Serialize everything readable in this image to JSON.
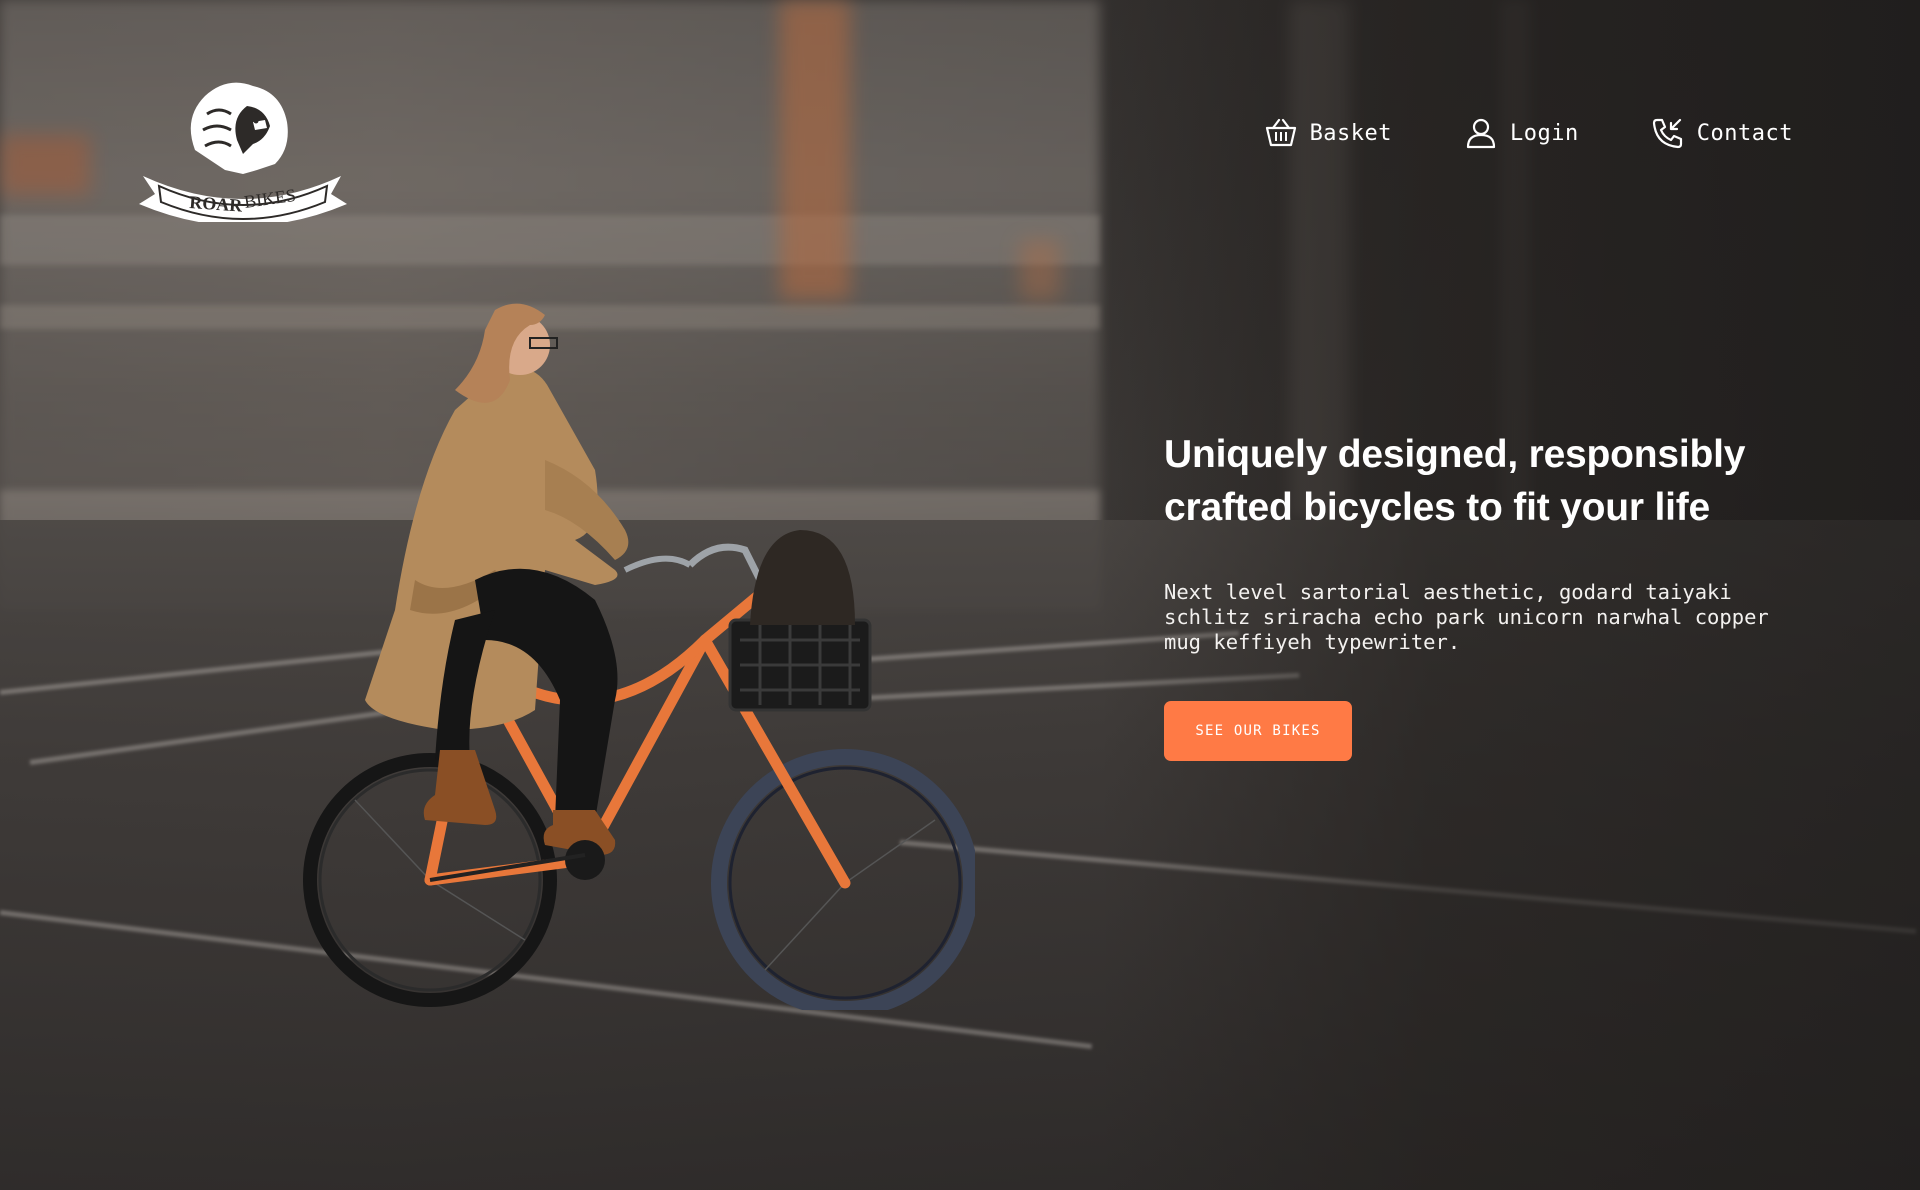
{
  "brand": {
    "name_primary": "ROAR",
    "name_secondary": "BIKES",
    "logo_icon": "lion-head-icon"
  },
  "nav": {
    "items": [
      {
        "label": "Basket",
        "icon": "basket-icon"
      },
      {
        "label": "Login",
        "icon": "user-icon"
      },
      {
        "label": "Contact",
        "icon": "phone-incoming-icon"
      }
    ]
  },
  "hero": {
    "headline": "Uniquely designed, responsibly crafted bicycles to fit your life",
    "body": "Next level sartorial aesthetic, godard taiyaki schlitz sriracha echo park unicorn narwhal copper mug keffiyeh typewriter.",
    "cta_label": "SEE OUR BIKES"
  },
  "colors": {
    "accent": "#ff7a45",
    "text": "#ffffff",
    "bike_frame": "#e8773a"
  }
}
